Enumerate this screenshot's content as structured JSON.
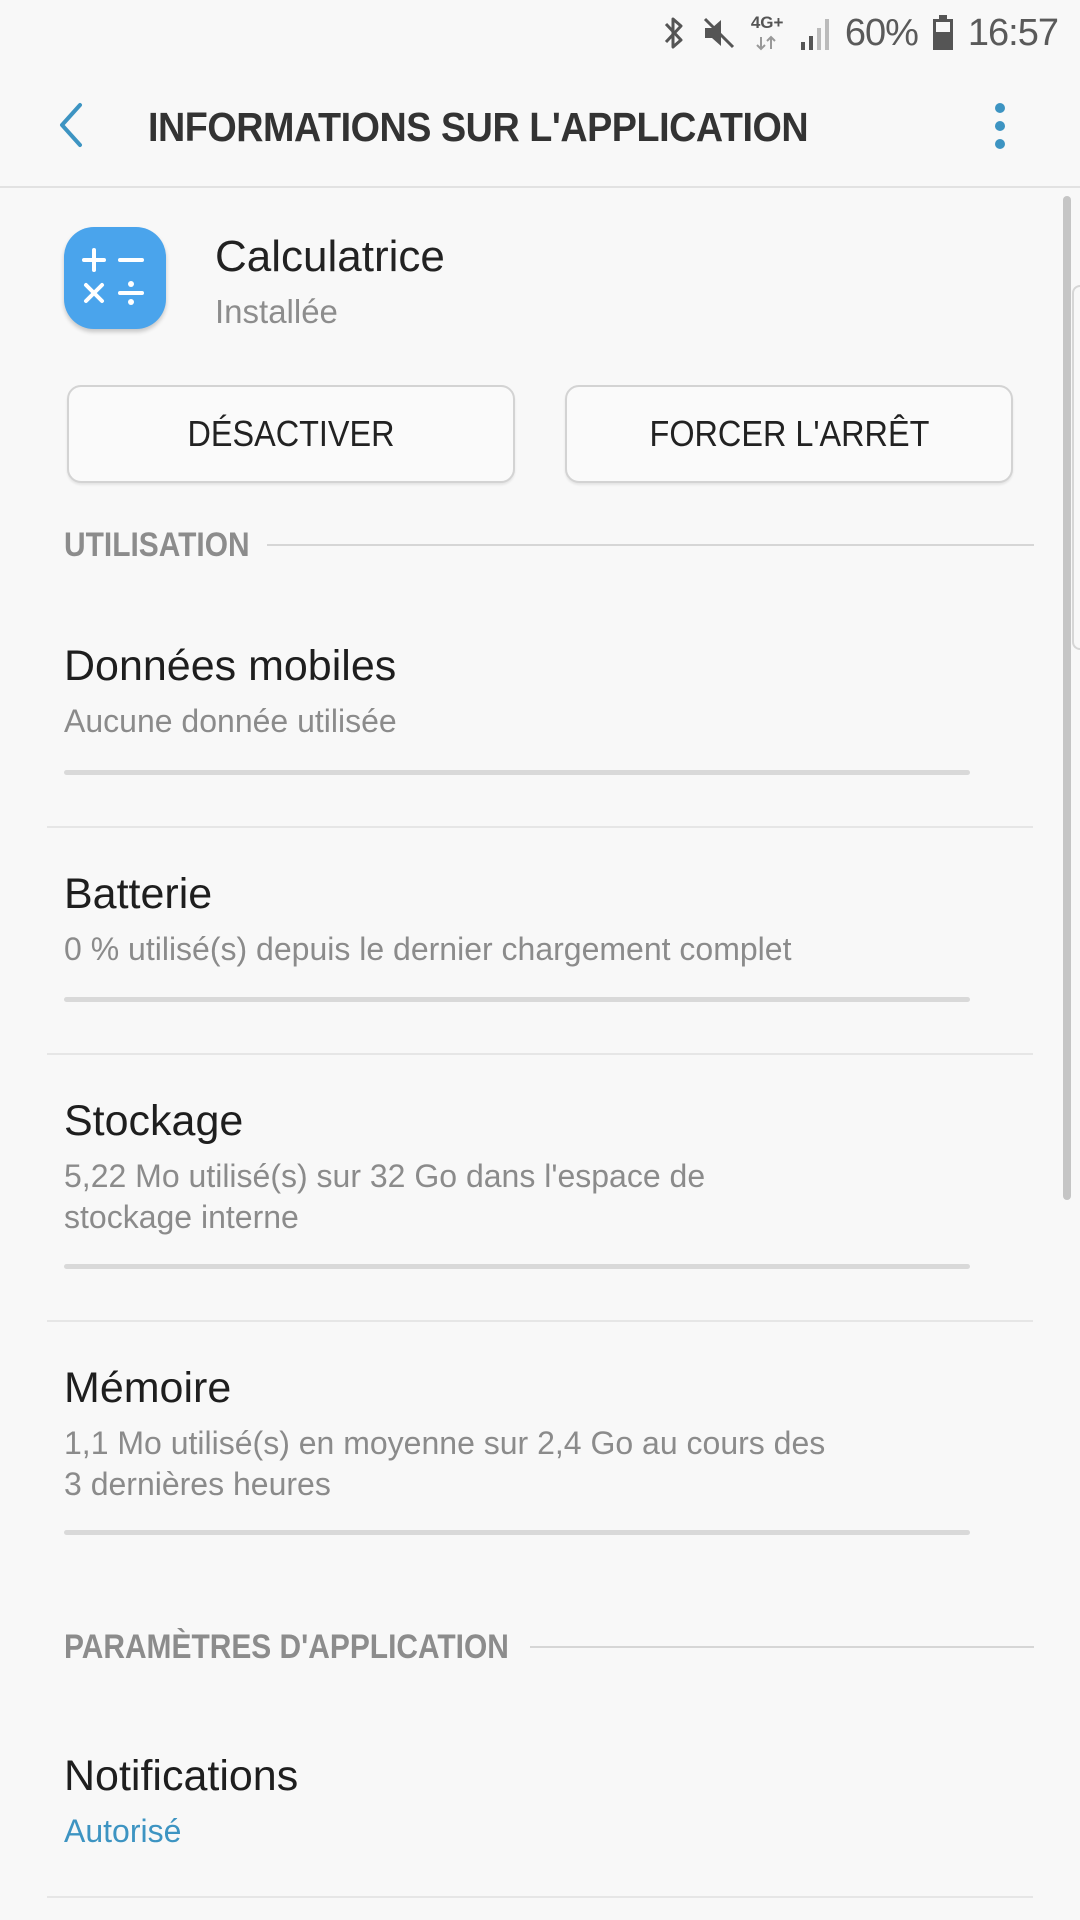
{
  "status_bar": {
    "network": "4G+",
    "battery_percent": "60%",
    "time": "16:57",
    "icons": [
      "bluetooth-icon",
      "mute-icon",
      "network-4g-icon",
      "signal-icon",
      "battery-icon"
    ]
  },
  "app_bar": {
    "title": "INFORMATIONS SUR L'APPLICATION",
    "back_icon": "chevron-left-icon",
    "menu_icon": "more-vert-icon"
  },
  "app": {
    "name": "Calculatrice",
    "status": "Installée",
    "icon": "calculator-icon",
    "icon_color": "#4aa4ec"
  },
  "buttons": {
    "disable": "DÉSACTIVER",
    "force_stop": "FORCER L'ARRÊT"
  },
  "sections": {
    "usage": "UTILISATION",
    "app_settings": "PARAMÈTRES D'APPLICATION"
  },
  "items": {
    "mobile_data": {
      "title": "Données mobiles",
      "subtitle": "Aucune donnée utilisée"
    },
    "battery": {
      "title": "Batterie",
      "subtitle": "0 % utilisé(s) depuis le dernier chargement complet"
    },
    "storage": {
      "title": "Stockage",
      "subtitle_line1": "5,22 Mo utilisé(s) sur 32 Go dans l'espace de",
      "subtitle_line2": "stockage interne"
    },
    "memory": {
      "title": "Mémoire",
      "subtitle_line1": "1,1 Mo utilisé(s) en moyenne sur 2,4 Go au cours des",
      "subtitle_line2": "3 dernières heures"
    },
    "notifications": {
      "title": "Notifications",
      "subtitle": "Autorisé"
    }
  },
  "colors": {
    "accent": "#3d94c2",
    "background": "#f8f8f8"
  }
}
